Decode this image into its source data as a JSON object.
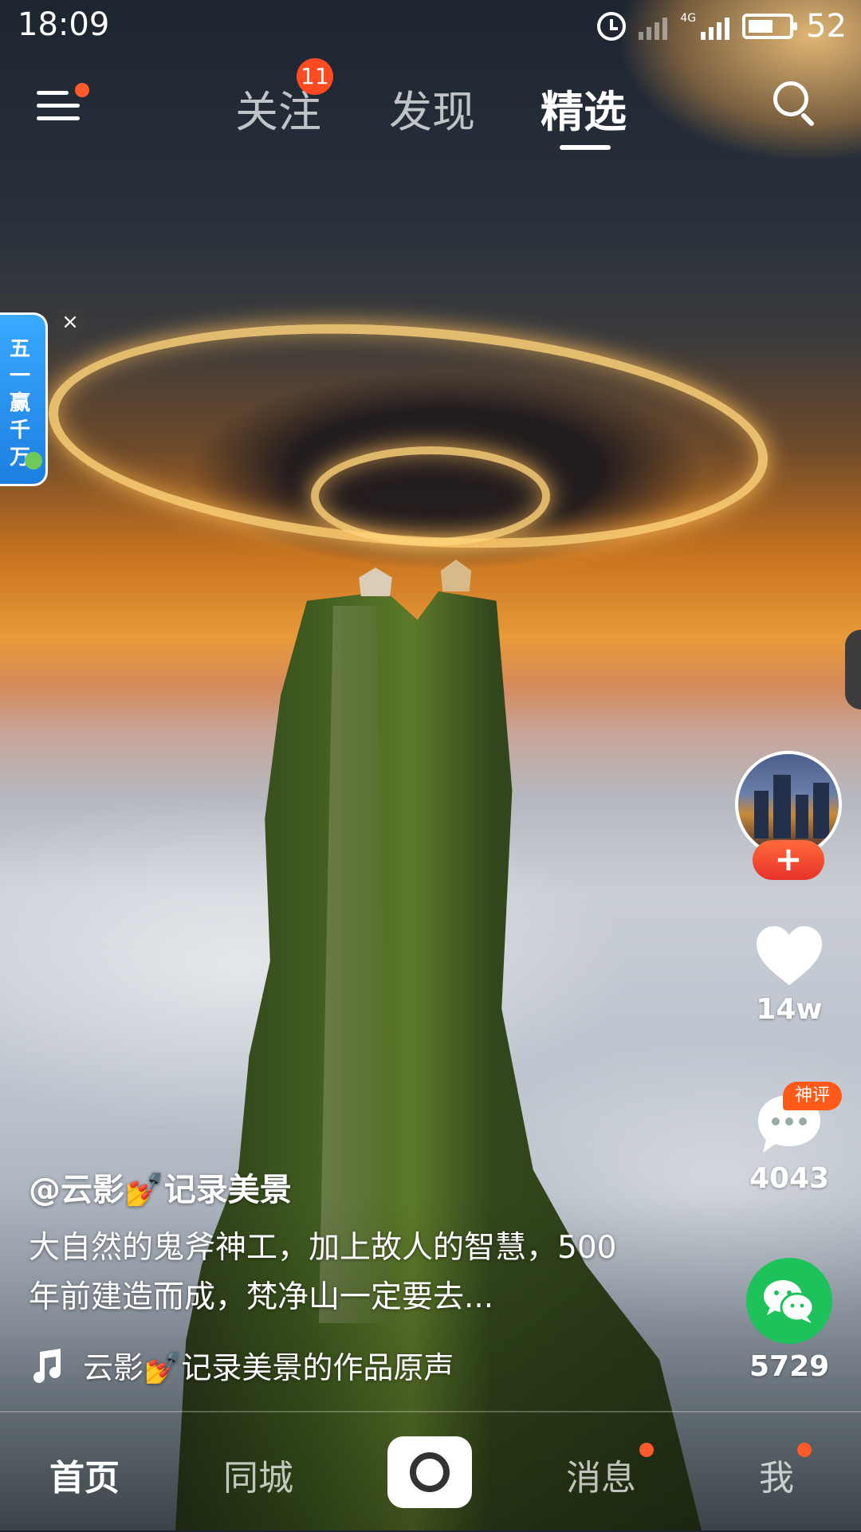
{
  "status_bar": {
    "time": "18:09",
    "network": "4G",
    "battery": "52"
  },
  "top_nav": {
    "tabs": [
      {
        "label": "关注",
        "badge": "11"
      },
      {
        "label": "发现"
      },
      {
        "label": "精选",
        "selected": true
      }
    ]
  },
  "promo": {
    "text": "五一赢千万",
    "close": "×"
  },
  "actions": {
    "follow": "+",
    "likes": "14w",
    "comments": "4043",
    "comment_tag": "神评",
    "shares": "5729"
  },
  "post": {
    "author": "@云影💅记录美景",
    "description": "大自然的鬼斧神工，加上故人的智慧，500年前建造而成，梵净山一定要去...",
    "music": "云影💅记录美景的作品原声"
  },
  "bottom_nav": {
    "home": "首页",
    "city": "同城",
    "messages": "消息",
    "me": "我"
  },
  "colors": {
    "accent_red": "#ff4a22",
    "wechat_green": "#1ec25a",
    "promo_blue": "#2a96f0"
  }
}
